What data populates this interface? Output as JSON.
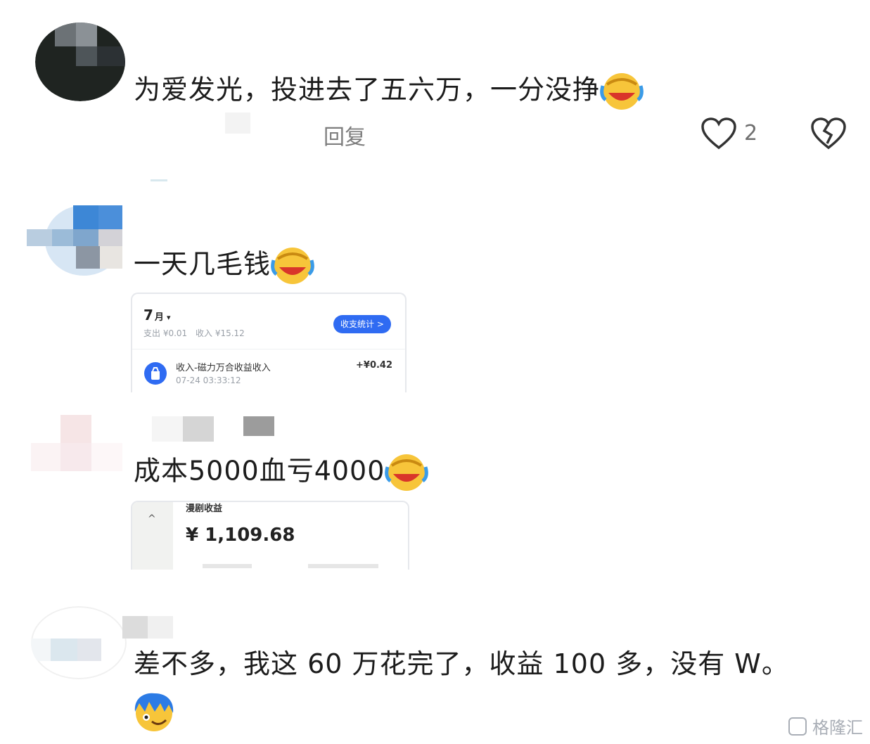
{
  "comments": [
    {
      "text": "为爱发光，投进去了五六万，一分没挣",
      "emoji": "laughing-crying-emoji",
      "reply_label": "回复",
      "like_count": "2"
    },
    {
      "text": "一天几毛钱",
      "emoji": "laughing-crying-emoji",
      "attachment": {
        "month": "7",
        "month_unit": "月",
        "dropdown": "▾",
        "expense": "支出 ¥0.01",
        "income": "收入 ¥15.12",
        "stats_button": "收支统计 >",
        "entry_title": "收入-磁力万合收益收入",
        "entry_time": "07-24 03:33:12",
        "entry_amount": "+¥0.42"
      }
    },
    {
      "text": "成本5000血亏4000",
      "emoji": "laughing-crying-emoji",
      "attachment": {
        "title": "漫剧收益",
        "amount": "¥ 1,109.68"
      }
    },
    {
      "text": "差不多，我这 60 万花完了，收益 100 多，没有 W。",
      "emoji": "blue-hair-face-emoji"
    }
  ],
  "watermark": "格隆汇",
  "colors": {
    "accent": "#2f6bf2",
    "emoji_yellow": "#f7c53a",
    "emoji_blue": "#2c7be5"
  }
}
